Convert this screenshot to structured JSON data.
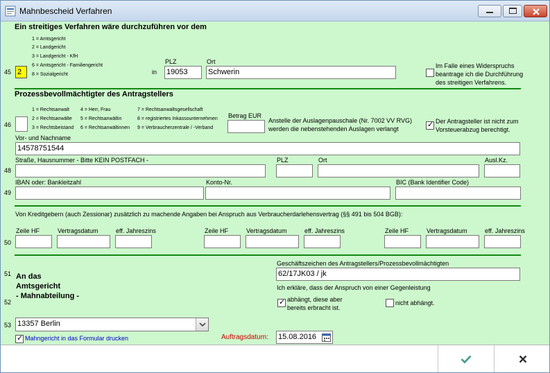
{
  "window": {
    "title": "Mahnbescheid Verfahren",
    "buttons": {
      "minimize": "—",
      "maximize": "□",
      "close": "✕"
    }
  },
  "section1": {
    "heading": "Ein streitiges Verfahren wäre durchzuführen vor dem",
    "row_number": "45",
    "court_options": [
      "1 = Amtsgericht",
      "2 = Landgericht",
      "3 = Landgericht - KfH",
      "6 = Amtsgericht - Familiengericht",
      "8 = Sozialgericht"
    ],
    "court_code": "2",
    "in_label": "in",
    "plz_label": "PLZ",
    "plz_value": "19053",
    "ort_label": "Ort",
    "ort_value": "Schwerin",
    "widerspruch_text": [
      "Im Falle eines Widerspruchs",
      "beantrage ich die Durchführung",
      "des streitigen Verfahrens."
    ],
    "widerspruch_checked": false
  },
  "section2": {
    "heading": "Prozessbevollmächtigter des Antragstellers",
    "row_46": "46",
    "legend_col1": [
      "1 = Rechtsanwalt",
      "2 = Rechtsanwälte",
      "3 = Rechtsbeistand"
    ],
    "legend_col2": [
      "4 = Herr, Frau",
      "5 = Rechtsanwältin",
      "6 = Rechtsanwältinnen"
    ],
    "legend_col3": [
      "7 = Rechtsanwaltsgesellschaft",
      "8 = registriertes Inkassounternehmen",
      "9 = Verbraucherzentrale / -Verband"
    ],
    "code_value": "",
    "betrag_label": "Betrag EUR",
    "betrag_value": "",
    "auslagen_text": [
      "Anstelle der Auslagenpauschale (Nr. 7002 VV RVG)",
      "werden die nebenstehenden Auslagen verlangt"
    ],
    "vorsteuer_text": [
      "Der Antragsteller ist nicht zum",
      "Vorsteuerabzug berechtigt."
    ],
    "vorsteuer_checked": true,
    "name_label": "Vor- und Nachname",
    "name_value": "14578751544",
    "row_48": "48",
    "strasse_label": "Straße, Hausnummer - Bitte KEIN POSTFACH -",
    "strasse_value": "",
    "plz_label": "PLZ",
    "plz_value": "",
    "ort_label": "Ort",
    "ort_value": "",
    "auslkz_label": "Ausl.Kz.",
    "auslkz_value": "",
    "row_49": "49",
    "iban_label": "IBAN oder:  Bankleitzahl",
    "iban_value": "",
    "konto_label": "Konto-Nr.",
    "konto_value": "",
    "bic_label": "BIC (Bank Identifier Code)",
    "bic_value": ""
  },
  "section3": {
    "note": "Von Kreditgebern (auch Zessionar) zusätzlich zu machende Angaben bei Anspruch aus Verbraucherdarlehensvertrag (§§ 491 bis 504 BGB):",
    "row_50": "50",
    "groups": [
      {
        "zeile_label": "Zeile HF",
        "datum_label": "Vertragsdatum",
        "zins_label": "eff. Jahreszins",
        "zeile": "",
        "datum": "",
        "zins": ""
      },
      {
        "zeile_label": "Zeile HF",
        "datum_label": "Vertragsdatum",
        "zins_label": "eff. Jahreszins",
        "zeile": "",
        "datum": "",
        "zins": ""
      },
      {
        "zeile_label": "Zeile HF",
        "datum_label": "Vertragsdatum",
        "zins_label": "eff. Jahreszins",
        "zeile": "",
        "datum": "",
        "zins": ""
      }
    ]
  },
  "section4": {
    "row_51": "51",
    "row_52": "52",
    "row_53": "53",
    "address": [
      "An das",
      "Amtsgericht",
      "- Mahnabteilung -"
    ],
    "geschaeftszeichen_label": "Geschäftszeichen des Antragstellers/Prozessbevollmächtigten",
    "geschaeftszeichen_value": "62/17JK03 / jk",
    "erklaerung": "Ich erkläre, dass der Anspruch von einer Gegenleistung",
    "abhaengt_text": [
      "abhängt, diese aber",
      "bereits erbracht ist."
    ],
    "abhaengt_checked": true,
    "nicht_abhaengt_text": "nicht abhängt.",
    "nicht_abhaengt_checked": false,
    "court_select": "13357 Berlin",
    "print_checkbox_label": "Mahngericht in das Formular drucken",
    "print_checked": true,
    "auftragsdatum_label": "Auftragsdatum:",
    "auftragsdatum_value": "15.08.2016"
  },
  "footer": {
    "ok_icon": "checkmark-icon",
    "cancel_icon": "x-icon"
  },
  "colors": {
    "background": "#cdf7cd",
    "divider": "#118a11",
    "highlight_input": "#ffff00",
    "blue_label": "#0000cc",
    "red_label": "#cc0000"
  }
}
